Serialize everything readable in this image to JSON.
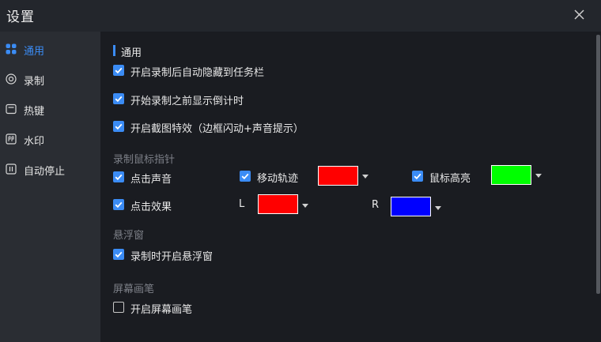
{
  "window": {
    "title": "设置"
  },
  "sidebar": {
    "items": [
      {
        "label": "通用",
        "icon": "grid-icon",
        "active": true
      },
      {
        "label": "录制",
        "icon": "record-icon",
        "active": false
      },
      {
        "label": "热键",
        "icon": "keyboard-icon",
        "active": false
      },
      {
        "label": "水印",
        "icon": "watermark-icon",
        "active": false
      },
      {
        "label": "自动停止",
        "icon": "pause-icon",
        "active": false
      }
    ]
  },
  "main": {
    "section_title": "通用",
    "general": {
      "hide_to_taskbar": {
        "label": "开启录制后自动隐藏到任务栏",
        "checked": true
      },
      "countdown": {
        "label": "开始录制之前显示倒计时",
        "checked": true
      },
      "capture_effect": {
        "label": "开启截图特效（边框闪动+声音提示）",
        "checked": true
      }
    },
    "cursor": {
      "title": "录制鼠标指针",
      "click_sound": {
        "label": "点击声音",
        "checked": true
      },
      "move_track": {
        "label": "移动轨迹",
        "checked": true,
        "color": "#ff0000"
      },
      "highlight": {
        "label": "鼠标高亮",
        "checked": true,
        "color": "#00ff00"
      },
      "click_effect": {
        "label": "点击效果",
        "checked": true
      },
      "left": {
        "label": "L",
        "color": "#ff0000"
      },
      "right": {
        "label": "R",
        "color": "#0000ff"
      }
    },
    "float": {
      "title": "悬浮窗",
      "open_on_record": {
        "label": "录制时开启悬浮窗",
        "checked": true
      }
    },
    "pen": {
      "title": "屏幕画笔",
      "enable": {
        "label": "开启屏幕画笔",
        "checked": false
      }
    }
  },
  "colors": {
    "accent": "#3b8cf5",
    "background": "#1a1c21",
    "sidebar": "#2a2d33"
  }
}
